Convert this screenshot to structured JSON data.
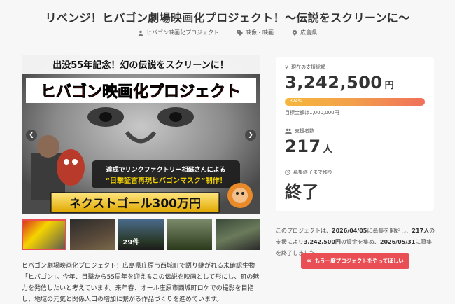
{
  "title": "リベンジ！ヒバゴン劇場映画化プロジェクト！～伝説をスクリーンに～",
  "meta": {
    "owner": "ヒバゴン映画化プロジェクト",
    "category": "映像・映画",
    "location": "広島県"
  },
  "hero": {
    "top_text": "出没55年記念！幻の伝説をスクリーンに！",
    "main_text": "ヒバゴン映画化プロジェクト",
    "collab_line1": "達成でリンクファクトリー相蘇さんによる",
    "collab_line2": "“目撃証言再現ヒバゴンマスク”制作！",
    "goal_text": "ネクストゴール300万円"
  },
  "thumbs": [
    "",
    "",
    "29件",
    "",
    ""
  ],
  "description": "ヒバゴン劇場映画化プロジェクト！広島県庄原市西城町で語り継がれる未確認生物「ヒバゴン」。今年、目撃から55周年を迎えるこの伝説を映画として形にし、町の魅力を発信したいと考えています。来年春、オール庄原市西城町ロケでの撮影を目指し、地域の元気と関係人口の増加に繋がる作品づくりを進めています。",
  "stats": {
    "total_label": "現在の支援総額",
    "total_value": "3,242,500",
    "yen": "円",
    "percent": "324%",
    "progress_fraction": 1.0,
    "goal_text": "目標金額は1,000,000円",
    "supporters_label": "支援者数",
    "supporters_value": "217",
    "supporters_unit": "人",
    "remaining_label": "募集終了まで残り",
    "remaining_value": "終了"
  },
  "summary": {
    "p1": "このプロジェクトは、",
    "start_date": "2026/04/05",
    "p2": "に募集を開始し、",
    "count": "217人",
    "p3": "の支援により",
    "amount": "3,242,500円",
    "p4": "の資金を集め、",
    "end_date": "2026/05/31",
    "p5": "に募集を終了しました"
  },
  "cta_label": "もう一度プロジェクトをやってほしい",
  "colors": {
    "accent": "#e94e55",
    "bar_start": "#f6b73c",
    "bar_end": "#f0705a",
    "hero_red": "#d8261f",
    "hero_yellow": "#f5d400"
  }
}
